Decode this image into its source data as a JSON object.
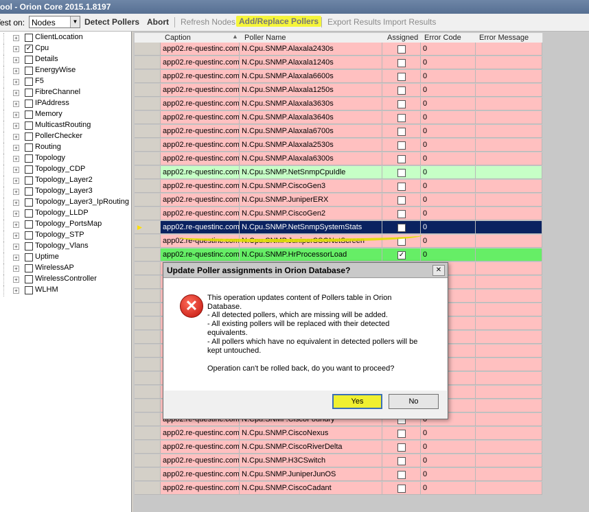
{
  "window": {
    "title": "ool - Orion Core 2015.1.8197"
  },
  "toolbar": {
    "test_on_label": "Test on:",
    "test_on_value": "Nodes",
    "detect": "Detect Pollers",
    "abort": "Abort",
    "refresh": "Refresh Nodes",
    "add_replace": "Add/Replace Pollers",
    "export": "Export Results",
    "import": "Import Results"
  },
  "tree": {
    "items": [
      {
        "label": "ClientLocation",
        "checked": false
      },
      {
        "label": "Cpu",
        "checked": true
      },
      {
        "label": "Details",
        "checked": false
      },
      {
        "label": "EnergyWise",
        "checked": false
      },
      {
        "label": "F5",
        "checked": false
      },
      {
        "label": "FibreChannel",
        "checked": false
      },
      {
        "label": "IPAddress",
        "checked": false
      },
      {
        "label": "Memory",
        "checked": false
      },
      {
        "label": "MulticastRouting",
        "checked": false
      },
      {
        "label": "PollerChecker",
        "checked": false
      },
      {
        "label": "Routing",
        "checked": false
      },
      {
        "label": "Topology",
        "checked": false
      },
      {
        "label": "Topology_CDP",
        "checked": false
      },
      {
        "label": "Topology_Layer2",
        "checked": false
      },
      {
        "label": "Topology_Layer3",
        "checked": false
      },
      {
        "label": "Topology_Layer3_IpRouting",
        "checked": false
      },
      {
        "label": "Topology_LLDP",
        "checked": false
      },
      {
        "label": "Topology_PortsMap",
        "checked": false
      },
      {
        "label": "Topology_STP",
        "checked": false
      },
      {
        "label": "Topology_Vlans",
        "checked": false
      },
      {
        "label": "Uptime",
        "checked": false
      },
      {
        "label": "WirelessAP",
        "checked": false
      },
      {
        "label": "WirelessController",
        "checked": false
      },
      {
        "label": "WLHM",
        "checked": false
      }
    ]
  },
  "grid": {
    "columns": [
      "Caption",
      "Poller Name",
      "Assigned",
      "Error Code",
      "Error Message"
    ],
    "rows": [
      {
        "caption": "app02.re-questinc.com",
        "poller": "N.Cpu.SNMP.Alaxala2430s",
        "assigned": false,
        "error_code": "0",
        "error_message": "",
        "status": "pink"
      },
      {
        "caption": "app02.re-questinc.com",
        "poller": "N.Cpu.SNMP.Alaxala1240s",
        "assigned": false,
        "error_code": "0",
        "error_message": "",
        "status": "pink"
      },
      {
        "caption": "app02.re-questinc.com",
        "poller": "N.Cpu.SNMP.Alaxala6600s",
        "assigned": false,
        "error_code": "0",
        "error_message": "",
        "status": "pink"
      },
      {
        "caption": "app02.re-questinc.com",
        "poller": "N.Cpu.SNMP.Alaxala1250s",
        "assigned": false,
        "error_code": "0",
        "error_message": "",
        "status": "pink"
      },
      {
        "caption": "app02.re-questinc.com",
        "poller": "N.Cpu.SNMP.Alaxala3630s",
        "assigned": false,
        "error_code": "0",
        "error_message": "",
        "status": "pink"
      },
      {
        "caption": "app02.re-questinc.com",
        "poller": "N.Cpu.SNMP.Alaxala3640s",
        "assigned": false,
        "error_code": "0",
        "error_message": "",
        "status": "pink"
      },
      {
        "caption": "app02.re-questinc.com",
        "poller": "N.Cpu.SNMP.Alaxala6700s",
        "assigned": false,
        "error_code": "0",
        "error_message": "",
        "status": "pink"
      },
      {
        "caption": "app02.re-questinc.com",
        "poller": "N.Cpu.SNMP.Alaxala2530s",
        "assigned": false,
        "error_code": "0",
        "error_message": "",
        "status": "pink"
      },
      {
        "caption": "app02.re-questinc.com",
        "poller": "N.Cpu.SNMP.Alaxala6300s",
        "assigned": false,
        "error_code": "0",
        "error_message": "",
        "status": "pink"
      },
      {
        "caption": "app02.re-questinc.com",
        "poller": "N.Cpu.SNMP.NetSnmpCpuIdle",
        "assigned": false,
        "error_code": "0",
        "error_message": "",
        "status": "lgreen"
      },
      {
        "caption": "app02.re-questinc.com",
        "poller": "N.Cpu.SNMP.CiscoGen3",
        "assigned": false,
        "error_code": "0",
        "error_message": "",
        "status": "pink"
      },
      {
        "caption": "app02.re-questinc.com",
        "poller": "N.Cpu.SNMP.JuniperERX",
        "assigned": false,
        "error_code": "0",
        "error_message": "",
        "status": "pink"
      },
      {
        "caption": "app02.re-questinc.com",
        "poller": "N.Cpu.SNMP.CiscoGen2",
        "assigned": false,
        "error_code": "0",
        "error_message": "",
        "status": "pink"
      },
      {
        "caption": "app02.re-questinc.com",
        "poller": "N.Cpu.SNMP.NetSnmpSystemStats",
        "assigned": false,
        "error_code": "0",
        "error_message": "",
        "status": "sel"
      },
      {
        "caption": "app02.re-questinc.com",
        "poller": "N.Cpu.SNMP.JuniperSSGNetScreen",
        "assigned": false,
        "error_code": "0",
        "error_message": "",
        "status": "pink"
      },
      {
        "caption": "app02.re-questinc.com",
        "poller": "N.Cpu.SNMP.HrProcessorLoad",
        "assigned": true,
        "error_code": "0",
        "error_message": "",
        "status": "green"
      }
    ],
    "bottom_rows": [
      {
        "caption": "app02.re-questinc.com",
        "poller": "N.Cpu.SNMP.CiscoFoundry",
        "assigned": false,
        "error_code": "0",
        "error_message": "",
        "status": "pink"
      },
      {
        "caption": "app02.re-questinc.com",
        "poller": "N.Cpu.SNMP.CiscoNexus",
        "assigned": false,
        "error_code": "0",
        "error_message": "",
        "status": "pink"
      },
      {
        "caption": "app02.re-questinc.com",
        "poller": "N.Cpu.SNMP.CiscoRiverDelta",
        "assigned": false,
        "error_code": "0",
        "error_message": "",
        "status": "pink"
      },
      {
        "caption": "app02.re-questinc.com",
        "poller": "N.Cpu.SNMP.H3CSwitch",
        "assigned": false,
        "error_code": "0",
        "error_message": "",
        "status": "pink"
      },
      {
        "caption": "app02.re-questinc.com",
        "poller": "N.Cpu.SNMP.JuniperJunOS",
        "assigned": false,
        "error_code": "0",
        "error_message": "",
        "status": "pink"
      },
      {
        "caption": "app02.re-questinc.com",
        "poller": "N.Cpu.SNMP.CiscoCadant",
        "assigned": false,
        "error_code": "0",
        "error_message": "",
        "status": "pink"
      }
    ]
  },
  "dialog": {
    "title": "Update Poller assignments in Orion Database?",
    "line1": "This operation updates content of Pollers table in Orion Database.",
    "bullet1": "- All detected pollers, which are missing will be added.",
    "bullet2a": "- All existing pollers will be replaced with their detected",
    "bullet2b": "equivalents.",
    "bullet3a": "- All pollers which have no equivalent in detected pollers will be",
    "bullet3b": "kept untouched.",
    "question": "Operation can't be rolled back, do you want to proceed?",
    "yes": "Yes",
    "no": "No"
  },
  "icons": {
    "error": "error-icon",
    "close": "close-icon",
    "dropdown": "chevron-down-icon",
    "row_pointer": "arrow-right-icon",
    "sort": "sort-up-icon"
  },
  "colors": {
    "row_pink": "#ffc0c0",
    "row_light_green": "#c6ffc6",
    "row_green": "#66ee66",
    "row_selected": "#0a2260",
    "highlight_yellow": "#f0f030"
  }
}
